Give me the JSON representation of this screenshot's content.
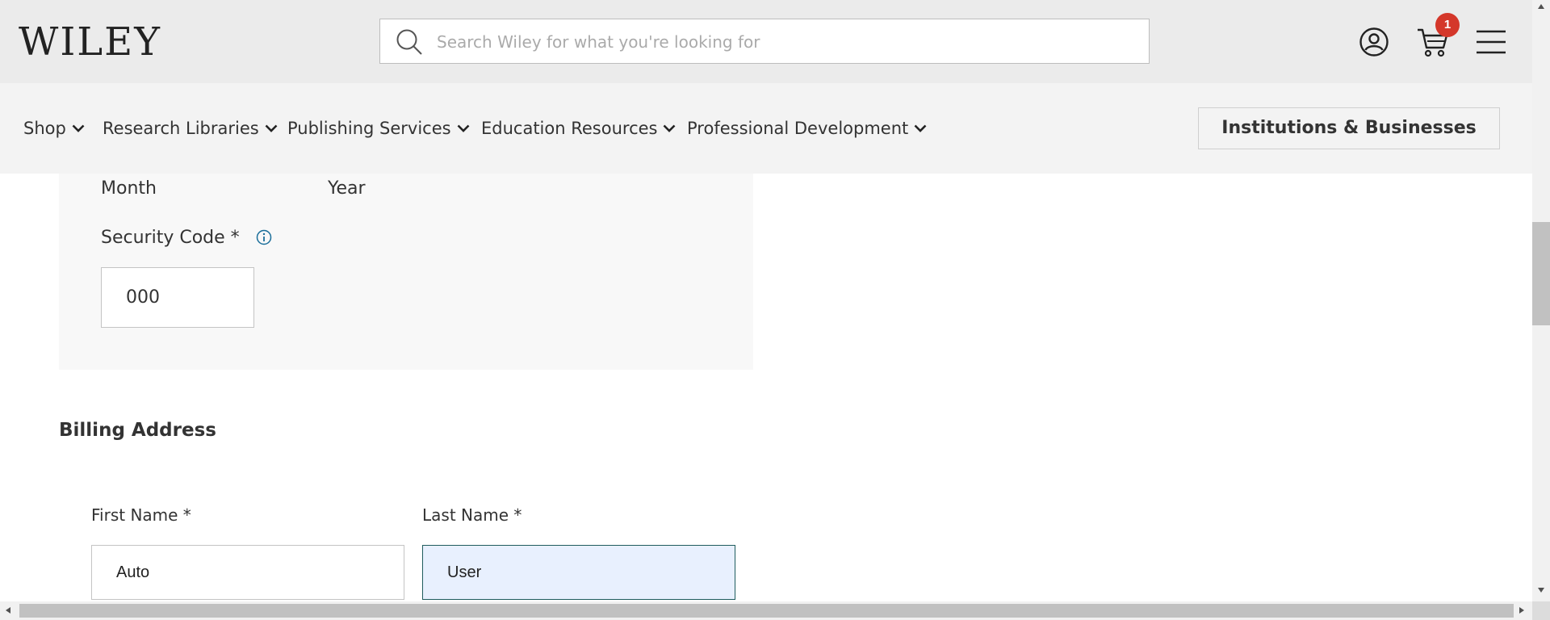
{
  "header": {
    "logo_text": "WILEY",
    "search": {
      "placeholder": "Search Wiley for what you're looking for",
      "value": ""
    },
    "cart_count": "1",
    "icons": [
      "search-icon",
      "account-icon",
      "cart-icon",
      "menu-icon"
    ]
  },
  "nav": {
    "items": [
      {
        "label": "Shop"
      },
      {
        "label": "Research Libraries"
      },
      {
        "label": "Publishing Services"
      },
      {
        "label": "Education Resources"
      },
      {
        "label": "Professional Development"
      }
    ],
    "institutions_button": "Institutions & Businesses"
  },
  "payment": {
    "month_label": "Month",
    "year_label": "Year",
    "security_code_label": "Security Code *",
    "security_code_value": "000"
  },
  "billing": {
    "title": "Billing Address",
    "first_name_label": "First Name *",
    "first_name_value": "Auto",
    "last_name_label": "Last Name *",
    "last_name_value": "User"
  },
  "colors": {
    "header_bg": "#ebebeb",
    "nav_bg": "#f3f3f3",
    "badge": "#d4372a",
    "active_field_bg": "#e8f0fe",
    "info_icon": "#1a6e9a"
  }
}
